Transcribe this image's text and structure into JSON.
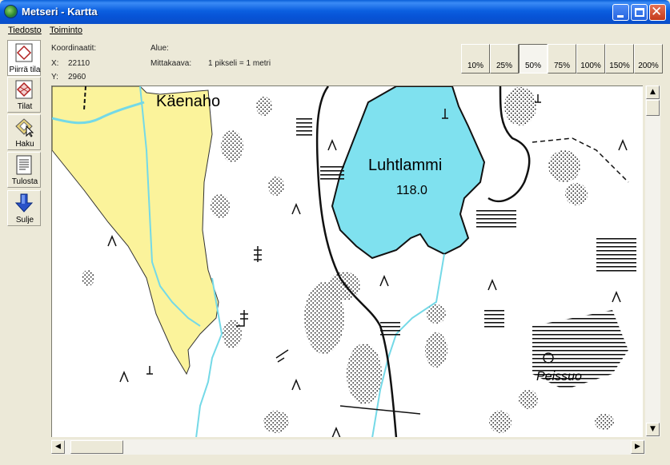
{
  "window": {
    "title": "Metseri - Kartta"
  },
  "menu": {
    "items": [
      {
        "label": "Tiedosto"
      },
      {
        "label": "Toiminto"
      }
    ]
  },
  "toolbar": {
    "tools": [
      {
        "label": "Piirrä tila",
        "icon": "draw-area-icon"
      },
      {
        "label": "Tilat",
        "icon": "areas-icon"
      },
      {
        "label": "Haku",
        "icon": "search-icon"
      },
      {
        "label": "Tulosta",
        "icon": "print-icon"
      },
      {
        "label": "Sulje",
        "icon": "close-arrow-icon"
      }
    ]
  },
  "info": {
    "coordinates_label": "Koordinaatit:",
    "x_label": "X:",
    "x_value": "22110",
    "y_label": "Y:",
    "y_value": "2960",
    "area_label": "Alue:",
    "scale_label": "Mittakaava:",
    "scale_value": "1 pikseli = 1 metri"
  },
  "zoom": {
    "options": [
      "10%",
      "25%",
      "50%",
      "75%",
      "100%",
      "150%",
      "200%"
    ],
    "selected": "50%"
  },
  "map": {
    "labels": {
      "place_1": "Käenaho",
      "lake_name": "Luhtlammi",
      "lake_elevation": "118.0",
      "swamp_name": "Peissuo"
    },
    "colors": {
      "field": "#fbf39b",
      "water": "#7fe1ef",
      "stream": "#74d9e7"
    }
  },
  "colors": {
    "titlebar": "#0b5fe0",
    "window_bg": "#ece9d8"
  }
}
